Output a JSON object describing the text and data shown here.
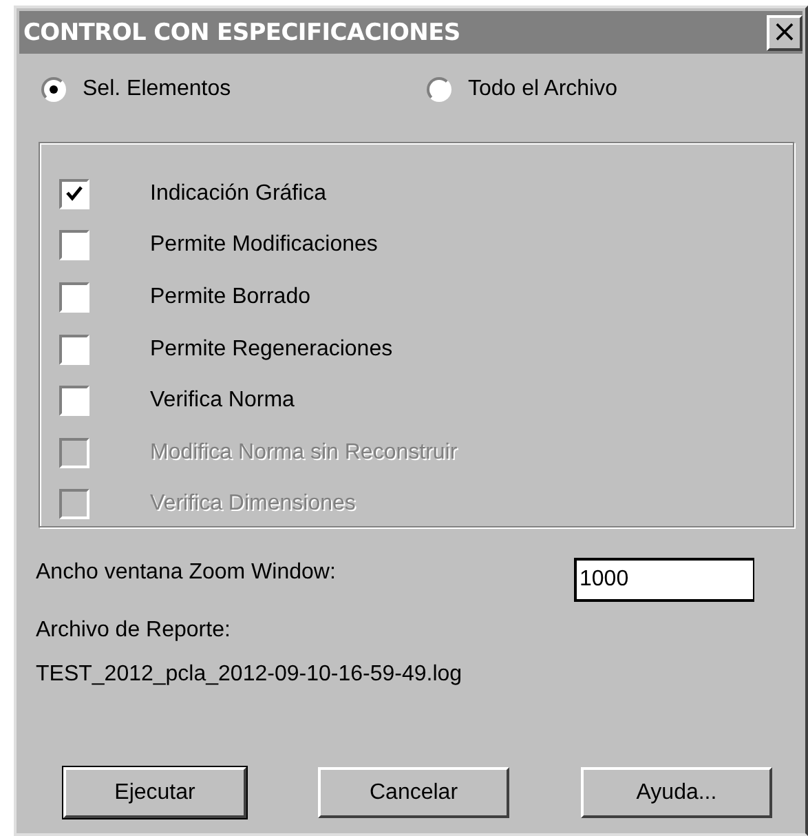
{
  "window": {
    "title": "CONTROL CON ESPECIFICACIONES",
    "close": "×"
  },
  "scope": [
    {
      "label": "Sel. Elementos",
      "selected": true
    },
    {
      "label": "Todo el Archivo",
      "selected": false
    }
  ],
  "options": [
    {
      "label": "Indicación Gráfica",
      "checked": true,
      "disabled": false
    },
    {
      "label": "Permite Modificaciones",
      "checked": false,
      "disabled": false
    },
    {
      "label": "Permite Borrado",
      "checked": false,
      "disabled": false
    },
    {
      "label": "Permite Regeneraciones",
      "checked": false,
      "disabled": false
    },
    {
      "label": "Verifica Norma",
      "checked": false,
      "disabled": false
    },
    {
      "label": "Modifica Norma sin Reconstruir",
      "checked": false,
      "disabled": true
    },
    {
      "label": "Verifica Dimensiones",
      "checked": false,
      "disabled": true
    }
  ],
  "zoom_width": {
    "label": "Ancho ventana Zoom Window:",
    "value": "1000"
  },
  "report": {
    "label": "Archivo de Reporte:",
    "file": "TEST_2012_pcla_2012-09-10-16-59-49.log"
  },
  "buttons": [
    {
      "label": "Ejecutar",
      "default": true
    },
    {
      "label": "Cancelar",
      "default": false
    },
    {
      "label": "Ayuda...",
      "default": false
    }
  ]
}
